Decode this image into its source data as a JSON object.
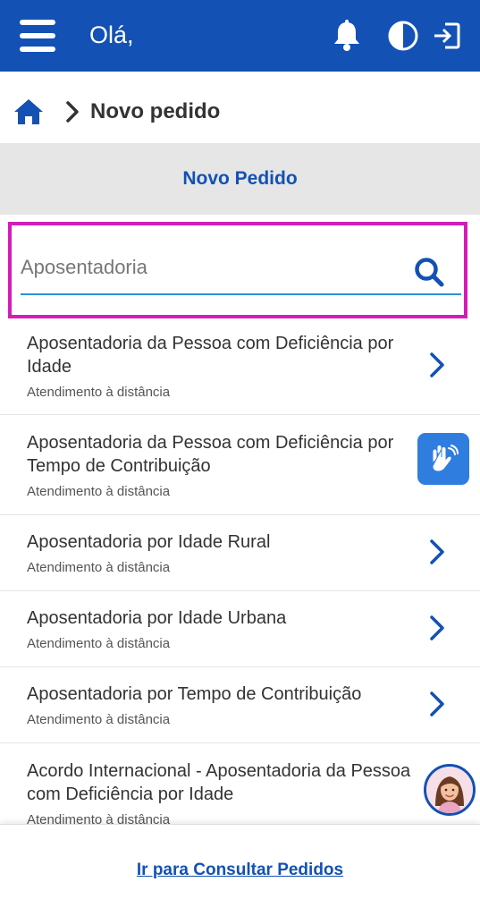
{
  "header": {
    "greeting": "Olá,",
    "menu_icon": "hamburger-menu-icon",
    "notification_icon": "bell-icon",
    "contrast_icon": "contrast-icon",
    "logout_icon": "sign-out-icon",
    "background_color": "#1351b4"
  },
  "breadcrumb": {
    "home_icon": "home-icon",
    "separator_icon": "chevron-right-icon",
    "current": "Novo pedido"
  },
  "section": {
    "title": "Novo Pedido"
  },
  "search": {
    "placeholder": "Aposentadoria",
    "value": "",
    "icon": "search-icon",
    "highlight_color": "#d61bb8"
  },
  "services": [
    {
      "title": "Aposentadoria da Pessoa com Deficiência por Idade",
      "subtitle": "Atendimento à distância"
    },
    {
      "title": "Aposentadoria da Pessoa com Deficiência por Tempo de Contribuição",
      "subtitle": "Atendimento à distância"
    },
    {
      "title": "Aposentadoria por Idade Rural",
      "subtitle": "Atendimento à distância"
    },
    {
      "title": "Aposentadoria por Idade Urbana",
      "subtitle": "Atendimento à distância"
    },
    {
      "title": "Aposentadoria por Tempo de Contribuição",
      "subtitle": "Atendimento à distância"
    },
    {
      "title": "Acordo Internacional - Aposentadoria da Pessoa com Deficiência por Idade",
      "subtitle": "Atendimento à distância"
    }
  ],
  "widgets": {
    "libras_icon": "sign-language-hands-icon",
    "assistant_icon": "virtual-assistant-avatar"
  },
  "footer": {
    "link": "Ir para Consultar Pedidos"
  },
  "colors": {
    "primary": "#1351b4",
    "search_underline": "#2b8fd3",
    "libras_button": "#2f7ddf"
  }
}
